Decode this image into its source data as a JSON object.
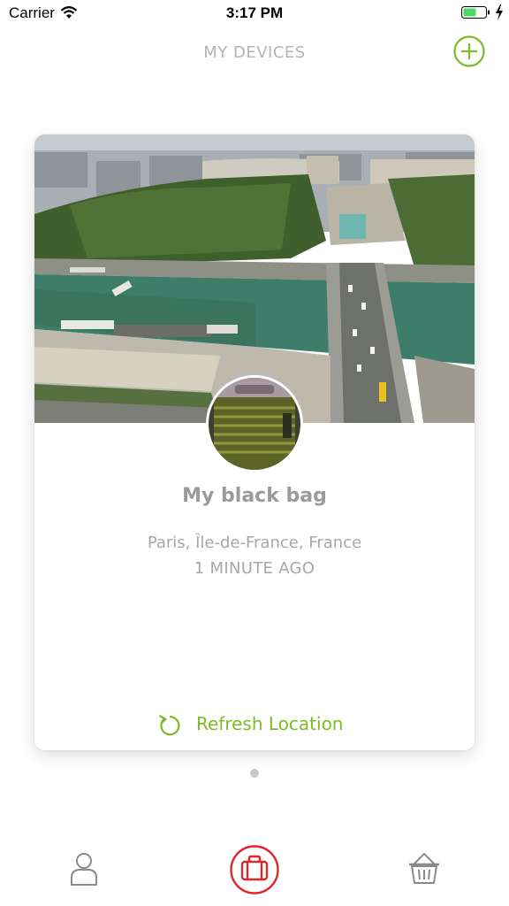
{
  "status_bar": {
    "carrier": "Carrier",
    "time": "3:17 PM"
  },
  "nav": {
    "title": "MY DEVICES",
    "add_icon": "plus-circle-icon"
  },
  "device_card": {
    "name": "My black bag",
    "location": "Paris, Île-de-France, France",
    "updated": "1 MINUTE AGO",
    "refresh_label": "Refresh Location",
    "refresh_icon": "refresh-icon"
  },
  "pagination": {
    "current": 1,
    "total": 1
  },
  "tab_bar": {
    "items": [
      "profile-icon",
      "suitcase-icon",
      "basket-icon"
    ],
    "active": "suitcase-icon"
  },
  "colors": {
    "accent_green": "#7cbb28",
    "active_red": "#e0262a",
    "text_gray": "#a8a8a8"
  }
}
